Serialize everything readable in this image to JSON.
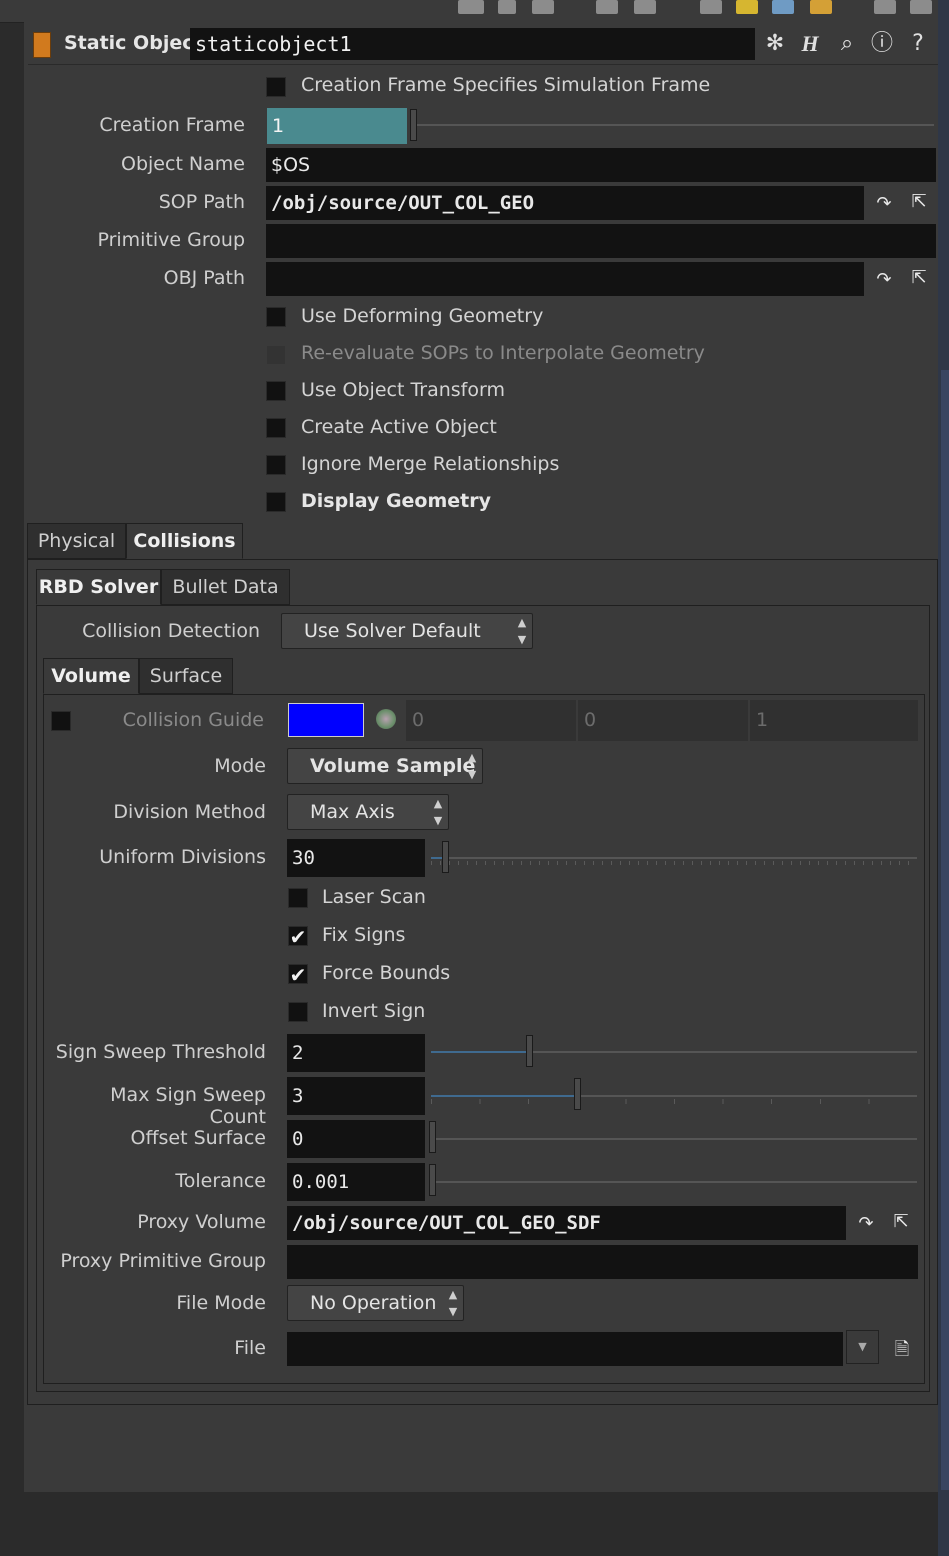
{
  "window": {
    "accent": "#4a8a8f",
    "color_swatch": "#0000ff"
  },
  "header": {
    "node_type": "Static Object",
    "node_name": "staticobject1",
    "icons": [
      "gear-icon",
      "h-help-icon",
      "search-icon",
      "info-icon",
      "help-icon"
    ]
  },
  "params": {
    "creation_frame_specifies_label": "Creation Frame Specifies Simulation Frame",
    "creation_frame_label": "Creation Frame",
    "creation_frame_value": "1",
    "object_name_label": "Object Name",
    "object_name_value": "$OS",
    "sop_path_label": "SOP Path",
    "sop_path_value": "/obj/source/OUT_COL_GEO",
    "primitive_group_label": "Primitive Group",
    "primitive_group_value": "",
    "obj_path_label": "OBJ Path",
    "obj_path_value": "",
    "use_deforming_label": "Use Deforming Geometry",
    "reevaluate_label": "Re-evaluate SOPs to Interpolate Geometry",
    "use_object_transform_label": "Use Object Transform",
    "create_active_label": "Create Active Object",
    "ignore_merge_label": "Ignore Merge Relationships",
    "display_geometry_label": "Display Geometry"
  },
  "tabs": {
    "main": [
      "Physical",
      "Collisions"
    ],
    "solver": [
      "RBD Solver",
      "Bullet Data"
    ],
    "volume": [
      "Volume",
      "Surface"
    ]
  },
  "collisions": {
    "collision_detection_label": "Collision Detection",
    "collision_detection_value": "Use Solver Default",
    "collision_guide_label": "Collision Guide",
    "collision_guide_values": [
      "0",
      "0",
      "1"
    ],
    "mode_label": "Mode",
    "mode_value": "Volume Sample",
    "division_method_label": "Division Method",
    "division_method_value": "Max Axis",
    "uniform_divisions_label": "Uniform Divisions",
    "uniform_divisions_value": "30",
    "laser_scan_label": "Laser Scan",
    "fix_signs_label": "Fix Signs",
    "force_bounds_label": "Force Bounds",
    "invert_sign_label": "Invert Sign",
    "sign_sweep_threshold_label": "Sign Sweep Threshold",
    "sign_sweep_threshold_value": "2",
    "max_sign_sweep_count_label": "Max Sign Sweep Count",
    "max_sign_sweep_count_value": "3",
    "offset_surface_label": "Offset Surface",
    "offset_surface_value": "0",
    "tolerance_label": "Tolerance",
    "tolerance_value": "0.001",
    "proxy_volume_label": "Proxy Volume",
    "proxy_volume_value": "/obj/source/OUT_COL_GEO_SDF",
    "proxy_primitive_group_label": "Proxy Primitive Group",
    "proxy_primitive_group_value": "",
    "file_mode_label": "File Mode",
    "file_mode_value": "No Operation",
    "file_label": "File",
    "file_value": ""
  }
}
